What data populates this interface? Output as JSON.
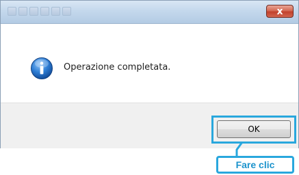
{
  "dialog": {
    "close_glyph": "x",
    "message": "Operazione completata.",
    "icon": "info-icon",
    "ok_label": "OK"
  },
  "callout": {
    "label": "Fare clic"
  },
  "colors": {
    "callout_blue": "#29a7dd",
    "close_red": "#c2412c",
    "titlebar": "#c4d8ec"
  }
}
